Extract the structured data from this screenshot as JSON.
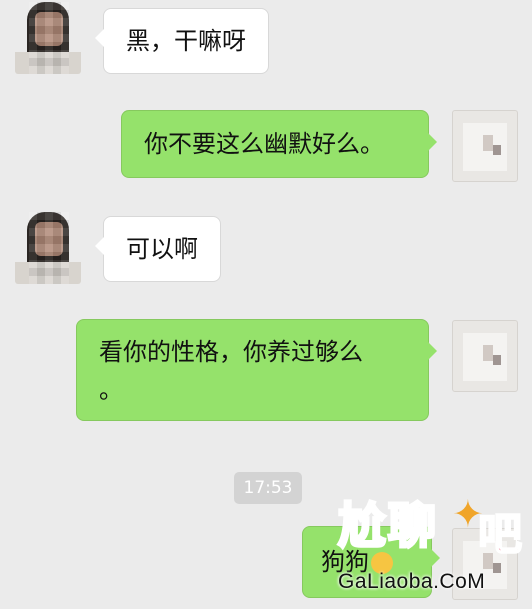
{
  "messages": [
    {
      "side": "in",
      "text": "黑，干嘛呀"
    },
    {
      "side": "out",
      "text": "你不要这么幽默好么。"
    },
    {
      "side": "in",
      "text": "可以啊"
    },
    {
      "side": "out",
      "line1": "看你的性格，你养过够么",
      "line2": "。"
    },
    {
      "side": "out",
      "text": "狗狗"
    }
  ],
  "timestamp": "17:53",
  "watermark": {
    "logo": "尬聊",
    "ba": "吧",
    "site": "GaLiaoba.CoM"
  },
  "colors": {
    "background": "#ebebeb",
    "outgoing": "#95e26b",
    "incoming": "#ffffff"
  }
}
